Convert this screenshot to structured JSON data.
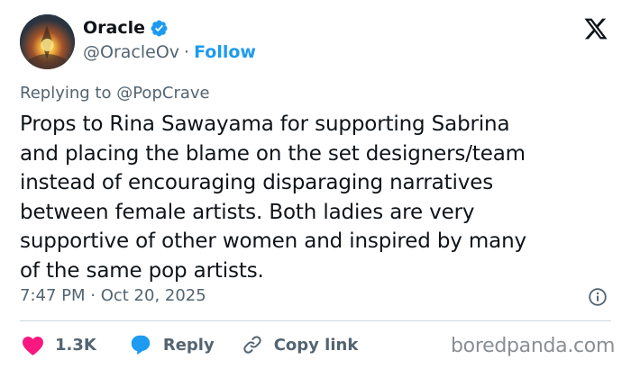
{
  "author": {
    "name": "Oracle",
    "handle": "@OracleOv",
    "follow_label": "Follow",
    "separator": "·",
    "verified": true
  },
  "reply_context": {
    "prefix": "Replying to",
    "mention": "@PopCrave"
  },
  "tweet": {
    "lines": [
      "Props to Rina Sawayama for supporting Sabrina",
      "and placing the blame on the set designers/team",
      "instead of encouraging disparaging narratives",
      "between female artists. Both ladies are very",
      "supportive of other women and inspired by many",
      "of the same pop artists."
    ],
    "timestamp": "7:47 PM · Oct 20, 2025"
  },
  "actions": {
    "like_count": "1.3K",
    "reply_label": "Reply",
    "copy_link_label": "Copy link"
  },
  "watermark": "boredpanda.com",
  "icons": {
    "verified": "verified-badge-icon",
    "platform": "x-logo-icon",
    "info": "info-icon",
    "like": "heart-icon",
    "reply": "speech-bubble-icon",
    "copy": "link-icon"
  },
  "colors": {
    "accent": "#1d9bf0",
    "like": "#f91880",
    "text": "#0f1419",
    "muted": "#536471"
  }
}
